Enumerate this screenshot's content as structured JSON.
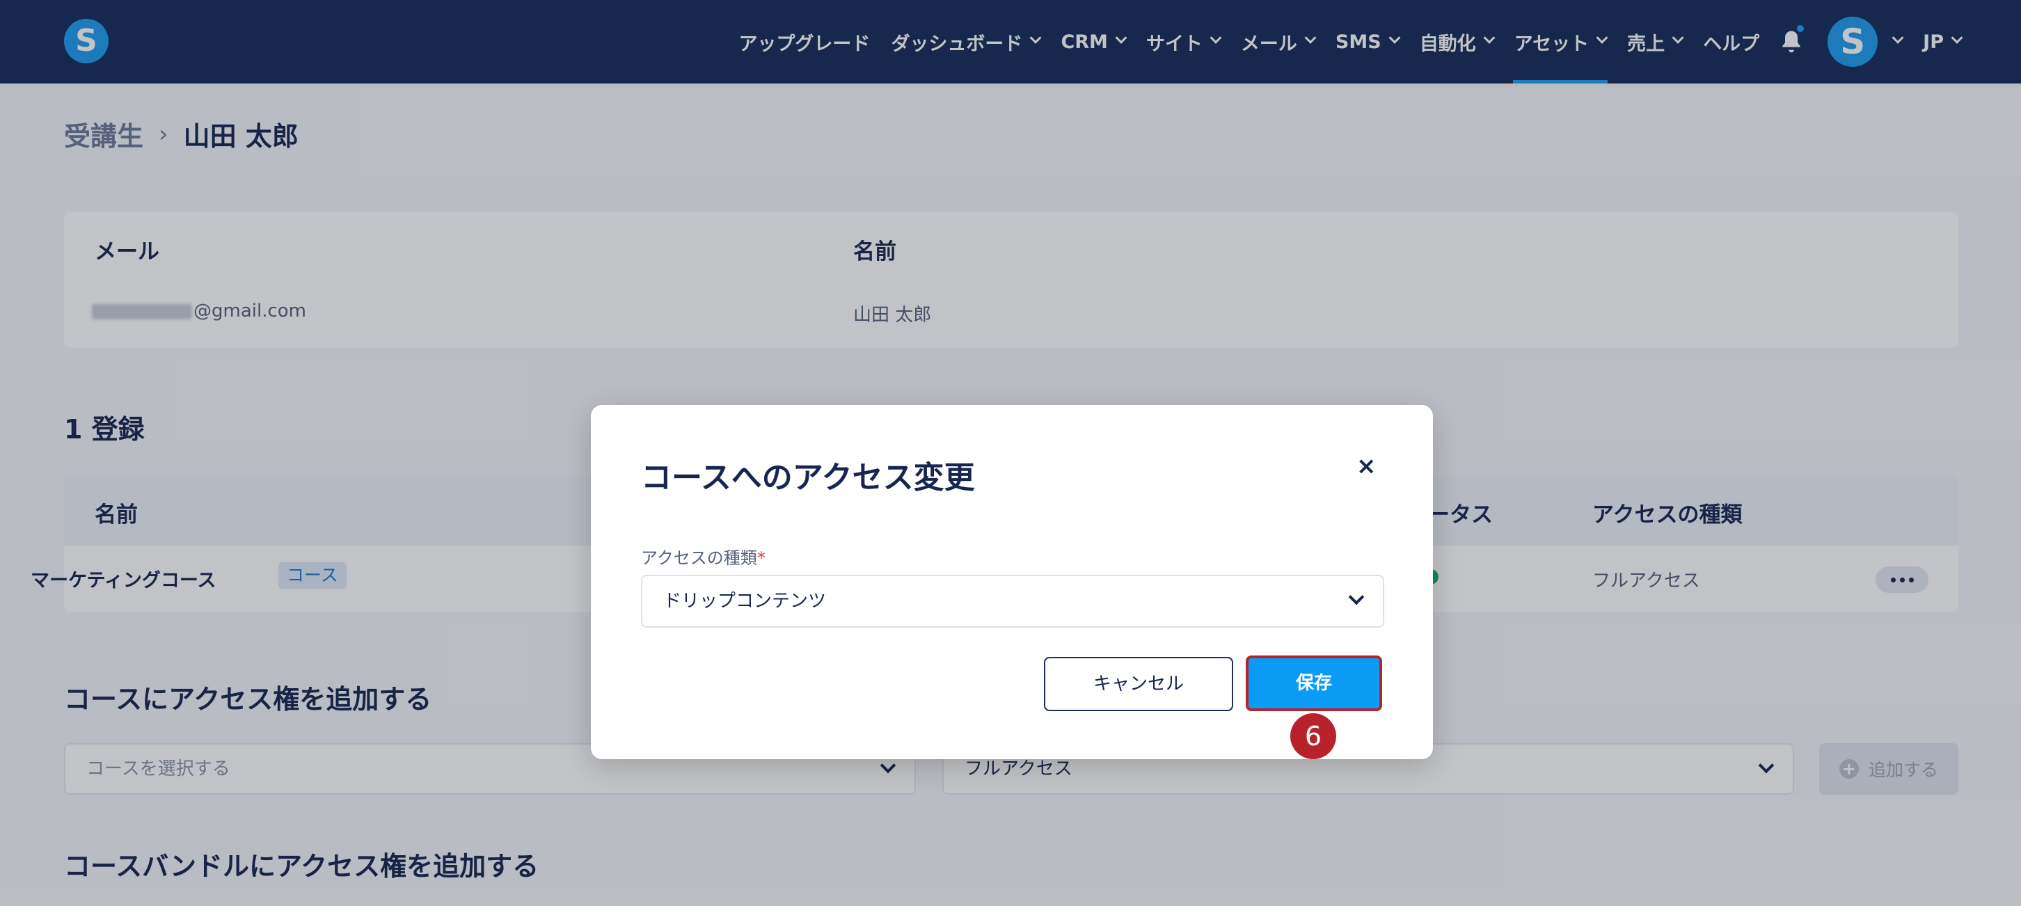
{
  "nav": {
    "logo_letter": "S",
    "items": [
      {
        "label": "アップグレード",
        "dropdown": false
      },
      {
        "label": "ダッシュボード",
        "dropdown": true
      },
      {
        "label": "CRM",
        "dropdown": true
      },
      {
        "label": "サイト",
        "dropdown": true
      },
      {
        "label": "メール",
        "dropdown": true
      },
      {
        "label": "SMS",
        "dropdown": true
      },
      {
        "label": "自動化",
        "dropdown": true
      },
      {
        "label": "アセット",
        "dropdown": true,
        "active": true
      },
      {
        "label": "売上",
        "dropdown": true
      },
      {
        "label": "ヘルプ",
        "dropdown": false
      }
    ],
    "avatar_letter": "S",
    "language": "JP"
  },
  "breadcrumb": {
    "parent": "受講生",
    "separator": "›",
    "current": "山田 太郎"
  },
  "info": {
    "email_label": "メール",
    "email_value": "@gmail.com",
    "name_label": "名前",
    "name_value": "山田 太郎"
  },
  "enrollments": {
    "title": "1 登録",
    "columns": {
      "name": "名前",
      "status": "ータス",
      "access_type": "アクセスの種類"
    },
    "row": {
      "name": "マーケティングコース",
      "tag": "コース",
      "access_type": "フルアクセス"
    }
  },
  "add_course": {
    "title": "コースにアクセス権を追加する",
    "course_placeholder": "コースを選択する",
    "access_value": "フルアクセス",
    "add_label": "追加する"
  },
  "add_bundle": {
    "title": "コースバンドルにアクセス権を追加する"
  },
  "modal": {
    "title": "コースへのアクセス変更",
    "close": "×",
    "field_label": "アクセスの種類",
    "required_mark": "*",
    "selected": "ドリップコンテンツ",
    "cancel": "キャンセル",
    "save": "保存"
  },
  "step_badge": "6",
  "colors": {
    "nav_bg": "#142b5a",
    "accent": "#1d9bf0",
    "save_bg": "#0a9cf5",
    "highlight": "#b8232b"
  }
}
